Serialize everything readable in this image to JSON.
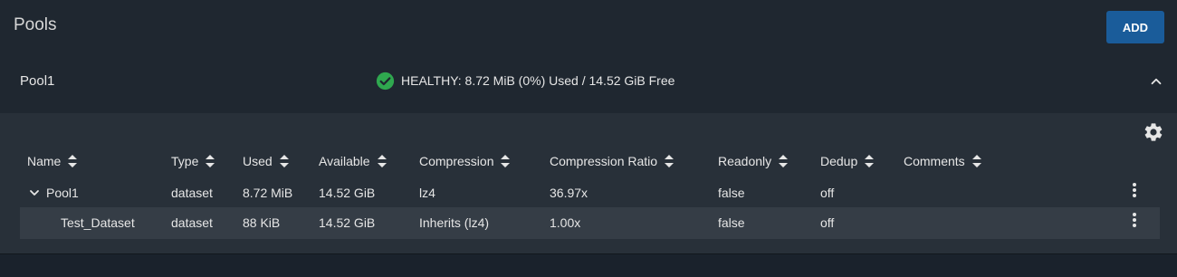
{
  "header": {
    "title": "Pools",
    "add_label": "ADD"
  },
  "pool": {
    "name": "Pool1",
    "status": "HEALTHY: 8.72 MiB (0%) Used / 14.52 GiB Free",
    "status_color": "#2fa84f"
  },
  "table": {
    "columns": [
      "Name",
      "Type",
      "Used",
      "Available",
      "Compression",
      "Compression Ratio",
      "Readonly",
      "Dedup",
      "Comments"
    ],
    "rows": [
      {
        "name": "Pool1",
        "type": "dataset",
        "used": "8.72 MiB",
        "available": "14.52 GiB",
        "compression": "lz4",
        "ratio": "36.97x",
        "readonly": "false",
        "dedup": "off",
        "comments": ""
      },
      {
        "name": "Test_Dataset",
        "type": "dataset",
        "used": "88 KiB",
        "available": "14.52 GiB",
        "compression": "Inherits (lz4)",
        "ratio": "1.00x",
        "readonly": "false",
        "dedup": "off",
        "comments": ""
      }
    ]
  },
  "icons": {
    "status": "check-circle-icon",
    "collapse": "chevron-up-icon",
    "settings": "gear-icon",
    "sort": "sort-icon",
    "expand": "chevron-down-icon",
    "actions": "more-vert-icon"
  },
  "colors": {
    "accent": "#1a5c9a",
    "background": "#1a222c",
    "panel": "#283039",
    "row_highlight": "#353d46"
  }
}
